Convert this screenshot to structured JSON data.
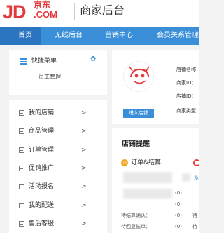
{
  "header": {
    "logo_text": "JD",
    "logo_cn": "京东",
    "logo_com": ".COM",
    "title": "商家后台"
  },
  "nav": {
    "items": [
      {
        "label": "首页",
        "active": true
      },
      {
        "label": "无线后台"
      },
      {
        "label": "营销中心"
      },
      {
        "label": "会员关系管理"
      }
    ]
  },
  "sidebar": {
    "quick_menu": {
      "title": "快捷菜单",
      "item": "员工管理",
      "settings_icon": "gear-icon"
    },
    "items": [
      {
        "label": "我的店铺",
        "chevron": ">"
      },
      {
        "label": "商品管理",
        "chevron": ">"
      },
      {
        "label": "订单管理",
        "chevron": ">"
      },
      {
        "label": "促销推广",
        "chevron": ">"
      },
      {
        "label": "活动报名",
        "chevron": ">"
      },
      {
        "label": "我的配送",
        "chevron": ">"
      },
      {
        "label": "售后客服",
        "chevron": ">"
      }
    ]
  },
  "shop_info": {
    "enter_button": "进入店铺",
    "lines": [
      "店铺名称",
      "商家ID：",
      "店铺ID：",
      "商家类型"
    ]
  },
  "reminders": {
    "title": "店铺提醒",
    "order_section": "订单&结算",
    "rows": [
      {
        "label": "待结算确认：",
        "value": "(0)",
        "frag": "待"
      },
      {
        "label": "待回复催单：",
        "value": "(0)",
        "frag": "待"
      }
    ],
    "side_values": [
      "(0)",
      "(0)"
    ]
  },
  "colors": {
    "brand": "#e4393c",
    "nav": "#3a8fd8",
    "nav_active": "#2a74c0"
  }
}
